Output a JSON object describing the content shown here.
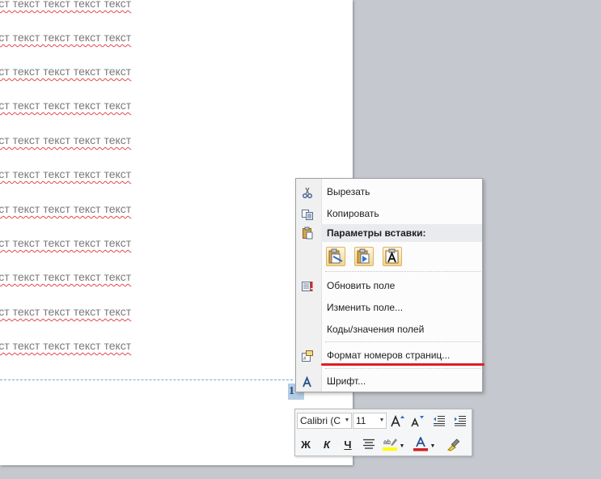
{
  "document": {
    "body_lines": [
      "кст текст текст текст текст",
      "кст текст текст текст текст",
      "кст текст текст текст текст",
      "кст текст текст текст текст",
      "кст текст текст текст текст",
      "кст текст текст текст текст",
      "кст текст текст текст текст",
      "кст текст текст текст текст",
      "кст текст текст текст текст",
      "кст текст текст текст текст",
      "кст текст текст текст текст"
    ],
    "page_number": "1"
  },
  "context_menu": {
    "cut": "Вырезать",
    "copy": "Копировать",
    "paste_options_header": "Параметры вставки:",
    "update_field": "Обновить поле",
    "edit_field": "Изменить поле...",
    "toggle_field_codes": "Коды/значения полей",
    "format_page_numbers": "Формат номеров страниц...",
    "font": "Шрифт..."
  },
  "mini_toolbar": {
    "font_name": "Calibri (С",
    "font_size": "11",
    "bold": "Ж",
    "italic": "К",
    "underline": "Ч"
  },
  "colors": {
    "highlight_marker": "#ffff00",
    "annotation_underline": "#dd1e25",
    "font_color": "#d42020"
  }
}
